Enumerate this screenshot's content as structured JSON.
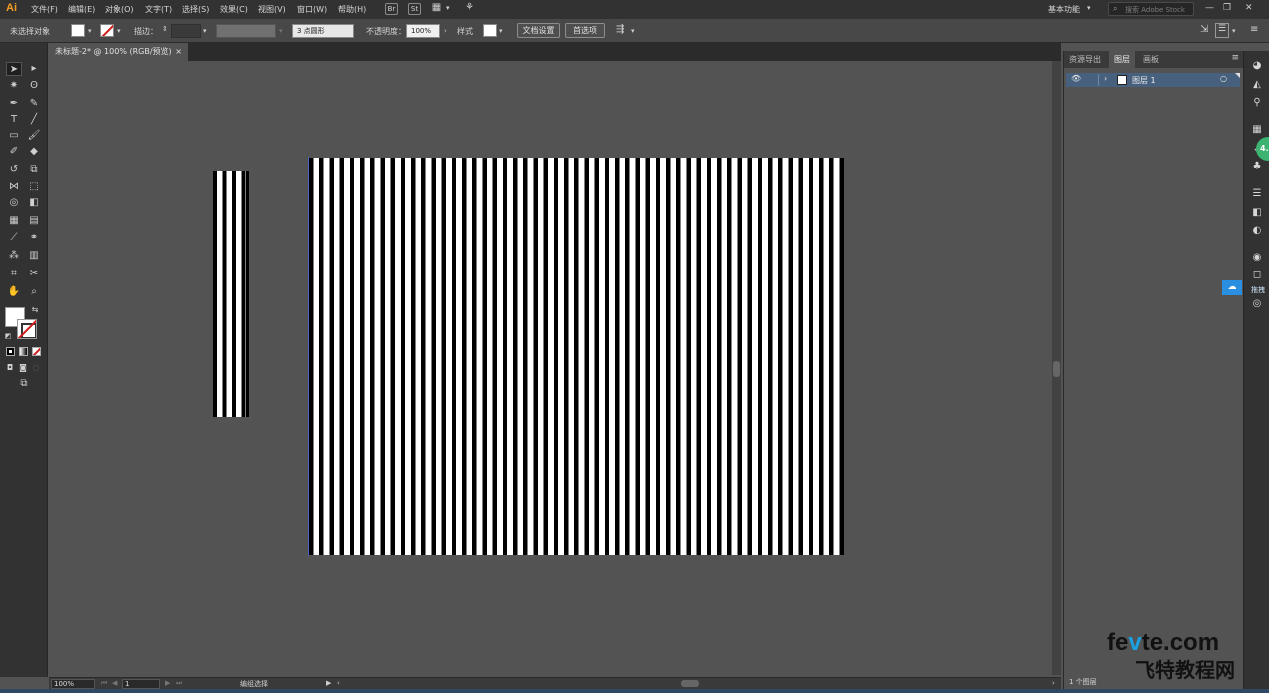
{
  "app": {
    "logo": "Ai"
  },
  "menubar": {
    "items": [
      "文件(F)",
      "编辑(E)",
      "对象(O)",
      "文字(T)",
      "选择(S)",
      "效果(C)",
      "视图(V)",
      "窗口(W)",
      "帮助(H)"
    ],
    "bridge_icon": "Br",
    "stock_icon": "St",
    "workspace": "基本功能",
    "search_placeholder": "搜索 Adobe Stock"
  },
  "control_bar": {
    "selection_status": "未选择对象",
    "stroke_label": "描边：",
    "brush_value": "3 点圆形",
    "opacity_label": "不透明度：",
    "opacity_value": "100%",
    "style_label": "样式",
    "doc_setup_button": "文档设置",
    "preferences_button": "首选项"
  },
  "document_tab": {
    "title": "未标题-2* @ 100% (RGB/预览)",
    "close": "×"
  },
  "status_bar": {
    "zoom": "100%",
    "artboard": "1",
    "status_text": "编组选择"
  },
  "layers_panel": {
    "tabs": [
      "资源导出",
      "图层",
      "画板"
    ],
    "active_tab": "图层",
    "layer_name": "图层 1",
    "layer_count": "1 个图层"
  },
  "side_tags": {
    "badge": "4.5",
    "cloud_label": "拖拽"
  },
  "watermark": {
    "line1_a": "fe",
    "line1_b": "v",
    "line1_c": "te.com",
    "line2": "飞特教程网"
  },
  "colors": {
    "stripe_black": "#000000",
    "stripe_white": "#ffffff",
    "layer_selected": "#46607e",
    "accent_blue": "#2a8fe0"
  }
}
